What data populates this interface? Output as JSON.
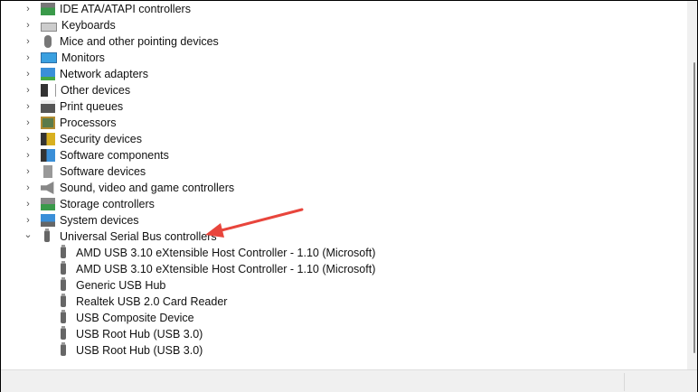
{
  "categories": [
    {
      "label": "IDE ATA/ATAPI controllers",
      "icon": "ide-controller-icon",
      "expanded": false
    },
    {
      "label": "Keyboards",
      "icon": "keyboard-icon",
      "expanded": false
    },
    {
      "label": "Mice and other pointing devices",
      "icon": "mouse-icon",
      "expanded": false
    },
    {
      "label": "Monitors",
      "icon": "monitor-icon",
      "expanded": false
    },
    {
      "label": "Network adapters",
      "icon": "network-adapter-icon",
      "expanded": false
    },
    {
      "label": "Other devices",
      "icon": "unknown-device-icon",
      "expanded": false
    },
    {
      "label": "Print queues",
      "icon": "printer-icon",
      "expanded": false
    },
    {
      "label": "Processors",
      "icon": "processor-icon",
      "expanded": false
    },
    {
      "label": "Security devices",
      "icon": "security-device-icon",
      "expanded": false
    },
    {
      "label": "Software components",
      "icon": "software-component-icon",
      "expanded": false
    },
    {
      "label": "Software devices",
      "icon": "software-device-icon",
      "expanded": false
    },
    {
      "label": "Sound, video and game controllers",
      "icon": "speaker-icon",
      "expanded": false
    },
    {
      "label": "Storage controllers",
      "icon": "storage-controller-icon",
      "expanded": false
    },
    {
      "label": "System devices",
      "icon": "system-folder-icon",
      "expanded": false
    },
    {
      "label": "Universal Serial Bus controllers",
      "icon": "usb-icon",
      "expanded": true
    }
  ],
  "usb_children": [
    "AMD USB 3.10 eXtensible Host Controller - 1.10 (Microsoft)",
    "AMD USB 3.10 eXtensible Host Controller - 1.10 (Microsoft)",
    "Generic USB Hub",
    "Realtek USB 2.0 Card Reader",
    "USB Composite Device",
    "USB Root Hub (USB 3.0)",
    "USB Root Hub (USB 3.0)"
  ],
  "colors": {
    "annotation_arrow": "#e8453c"
  }
}
